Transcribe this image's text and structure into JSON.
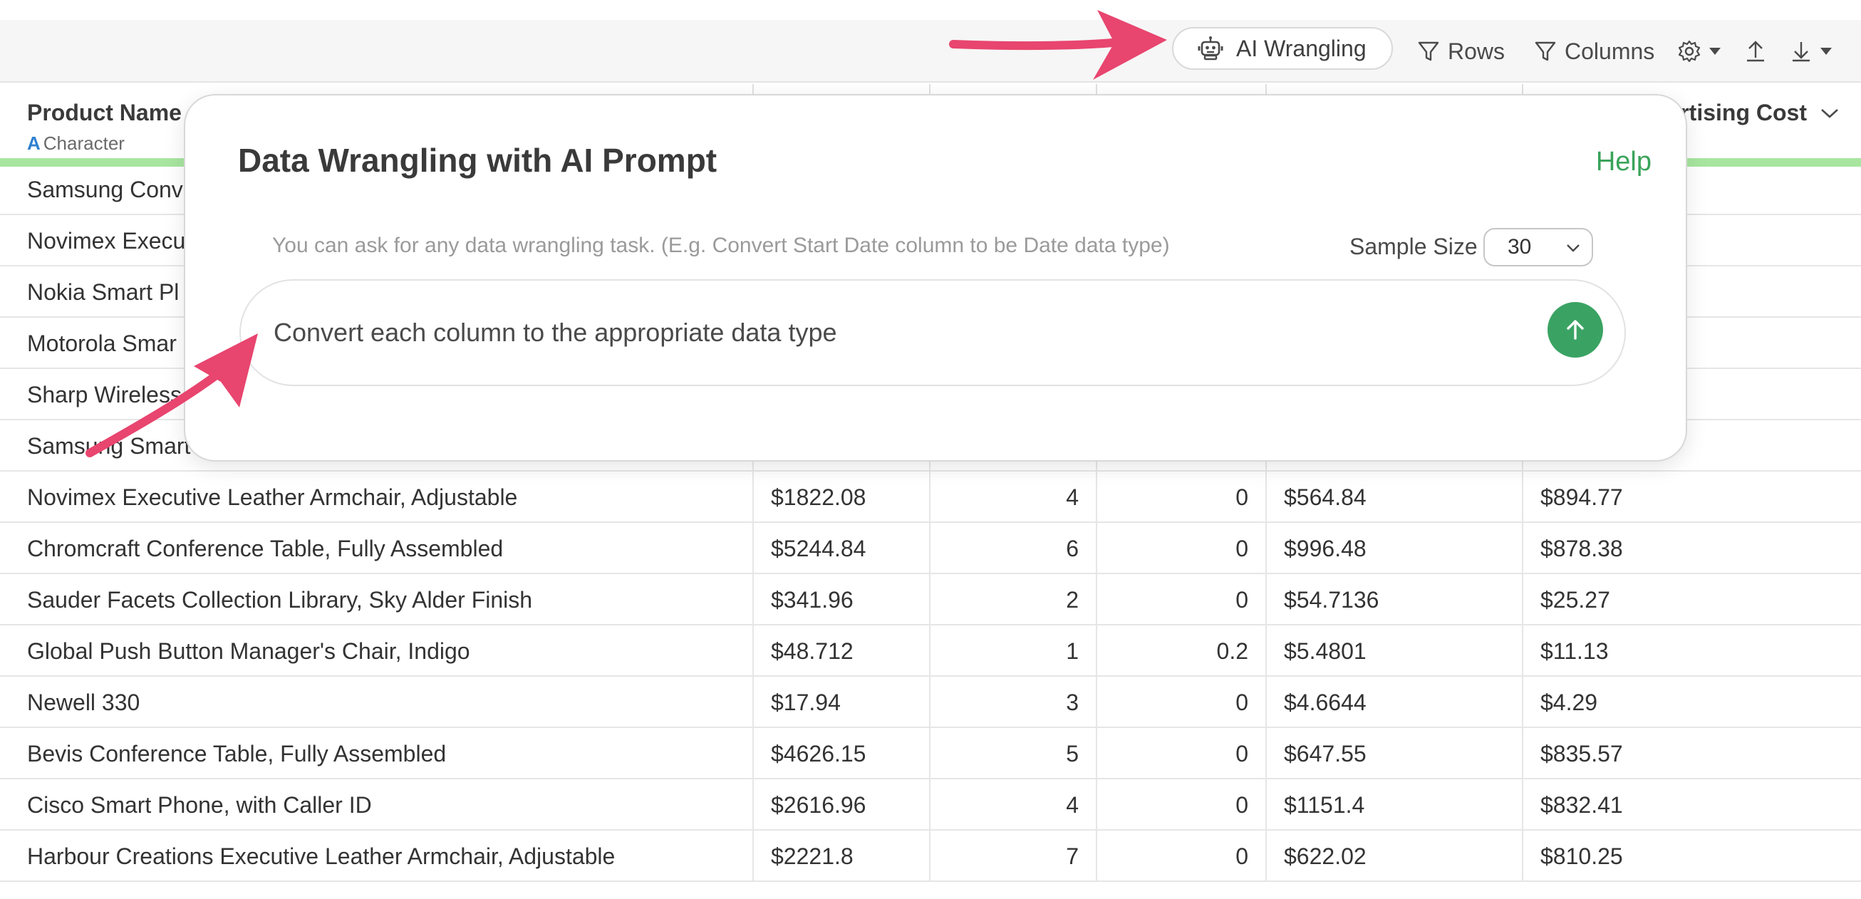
{
  "toolbar": {
    "ai_wrangling": "AI Wrangling",
    "rows": "Rows",
    "columns": "Columns"
  },
  "columns": [
    {
      "name": "Product Name",
      "type": "Character",
      "type_glyph": "A"
    },
    {
      "name": ""
    },
    {
      "name": ""
    },
    {
      "name": ""
    },
    {
      "name": ""
    },
    {
      "name": "rtising Cost"
    }
  ],
  "rows": [
    {
      "product": "Samsung Conv",
      "sales": "",
      "qty": "",
      "discount": "",
      "profit": "",
      "ad_cost": ""
    },
    {
      "product": "Novimex Execu",
      "sales": "",
      "qty": "",
      "discount": "",
      "profit": "",
      "ad_cost": ""
    },
    {
      "product": "Nokia Smart Pl",
      "sales": "",
      "qty": "",
      "discount": "",
      "profit": "",
      "ad_cost": ""
    },
    {
      "product": "Motorola Smar",
      "sales": "",
      "qty": "",
      "discount": "",
      "profit": "",
      "ad_cost": ""
    },
    {
      "product": "Sharp Wireless",
      "sales": "",
      "qty": "",
      "discount": "",
      "profit": "",
      "ad_cost": ""
    },
    {
      "product": "Samsung Smart",
      "sales": "",
      "qty": "",
      "discount": "",
      "profit": "",
      "ad_cost": ""
    },
    {
      "product": "Novimex Executive Leather Armchair, Adjustable",
      "sales": "$1822.08",
      "qty": "4",
      "discount": "0",
      "profit": "$564.84",
      "ad_cost": "$894.77"
    },
    {
      "product": "Chromcraft Conference Table, Fully Assembled",
      "sales": "$5244.84",
      "qty": "6",
      "discount": "0",
      "profit": "$996.48",
      "ad_cost": "$878.38"
    },
    {
      "product": "Sauder Facets Collection Library, Sky Alder Finish",
      "sales": "$341.96",
      "qty": "2",
      "discount": "0",
      "profit": "$54.7136",
      "ad_cost": "$25.27"
    },
    {
      "product": "Global Push Button Manager's Chair, Indigo",
      "sales": "$48.712",
      "qty": "1",
      "discount": "0.2",
      "profit": "$5.4801",
      "ad_cost": "$11.13"
    },
    {
      "product": "Newell 330",
      "sales": "$17.94",
      "qty": "3",
      "discount": "0",
      "profit": "$4.6644",
      "ad_cost": "$4.29"
    },
    {
      "product": "Bevis Conference Table, Fully Assembled",
      "sales": "$4626.15",
      "qty": "5",
      "discount": "0",
      "profit": "$647.55",
      "ad_cost": "$835.57"
    },
    {
      "product": "Cisco Smart Phone, with Caller ID",
      "sales": "$2616.96",
      "qty": "4",
      "discount": "0",
      "profit": "$1151.4",
      "ad_cost": "$832.41"
    },
    {
      "product": "Harbour Creations Executive Leather Armchair, Adjustable",
      "sales": "$2221.8",
      "qty": "7",
      "discount": "0",
      "profit": "$622.02",
      "ad_cost": "$810.25"
    }
  ],
  "modal": {
    "title": "Data Wrangling with AI Prompt",
    "help": "Help",
    "hint": "You can ask for any data wrangling task. (E.g. Convert Start Date column to be Date data type)",
    "sample_size_label": "Sample Size",
    "sample_size_value": "30",
    "prompt_value": "Convert each column to the appropriate data type"
  },
  "colors": {
    "accent_green": "#3aa363",
    "highlight_arrow": "#e8456f",
    "column_valid_bar": "#a8e6a0"
  }
}
